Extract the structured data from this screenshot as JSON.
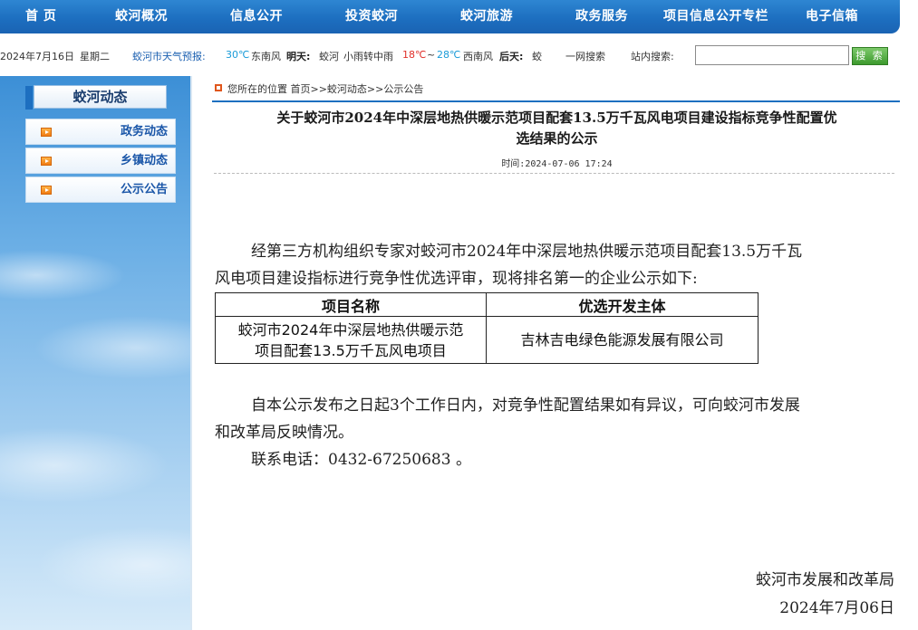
{
  "nav": {
    "items": [
      "首 页",
      "蛟河概况",
      "信息公开",
      "投资蛟河",
      "蛟河旅游",
      "政务服务",
      "项目信息公开专栏",
      "电子信箱"
    ]
  },
  "infobar": {
    "date": "2024年7月16日",
    "weekday": "星期二",
    "weather_label": "蛟河市天气预报:",
    "today_temp": "30℃",
    "today_wind": "东南风",
    "tomorrow_label": "明天:",
    "tomorrow_place": "蛟河",
    "tomorrow_weather": "小雨转中雨",
    "tomorrow_low": "18℃",
    "tomorrow_sep": "~",
    "tomorrow_high": "28℃",
    "tomorrow_wind": "西南风",
    "after_label": "后天:",
    "after_place": "蛟",
    "one_net_search": "一网搜索",
    "site_search_label": "站内搜索:",
    "search_value": "",
    "search_button": "搜 索"
  },
  "sidebar": {
    "title": "蛟河动态",
    "items": [
      {
        "label": "政务动态"
      },
      {
        "label": "乡镇动态"
      },
      {
        "label": "公示公告"
      }
    ]
  },
  "breadcrumb": {
    "text": "您所在的位置 首页>>蛟河动态>>公示公告"
  },
  "article": {
    "title_line1": "关于蛟河市2024年中深层地热供暖示范项目配套13.5万千瓦风电项目建设指标竞争性配置优",
    "title_line2": "选结果的公示",
    "time": "时间:2024-07-06 17:24",
    "para1_line1": "经第三方机构组织专家对蛟河市2024年中深层地热供暖示范项目配套13.5万千瓦",
    "para1_line2": "风电项目建设指标进行竞争性优选评审，现将排名第一的企业公示如下:",
    "table": {
      "headers": [
        "项目名称",
        "优选开发主体"
      ],
      "row": {
        "project_line1": "蛟河市2024年中深层地热供暖示范",
        "project_line2": "项目配套13.5万千瓦风电项目",
        "company": "吉林吉电绿色能源发展有限公司"
      }
    },
    "para2_line1": "自本公示发布之日起3个工作日内，对竞争性配置结果如有异议，可向蛟河市发展",
    "para2_line2": "和改革局反映情况。",
    "contact": "联系电话：0432-67250683 。",
    "signature_org": "蛟河市发展和改革局",
    "signature_date": "2024年7月06日"
  }
}
